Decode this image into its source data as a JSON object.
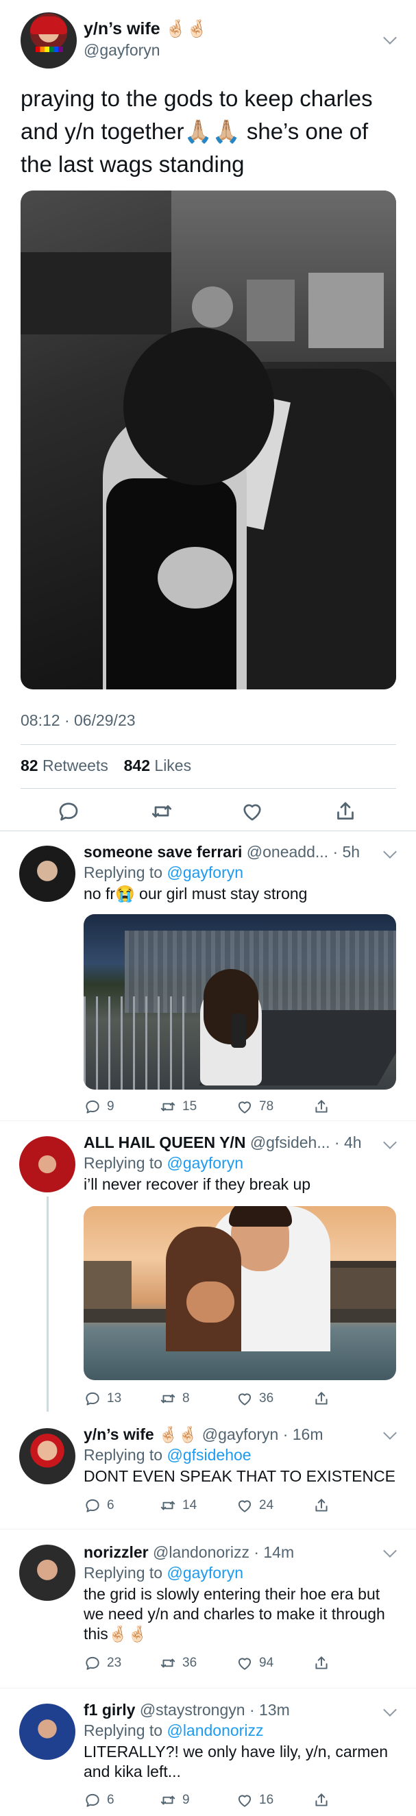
{
  "main_tweet": {
    "author_name": "y/n’s wife 🤞🏻🤞🏻",
    "author_handle": "@gayforyn",
    "text": "praying to the gods to keep charles and y/n together🙏🏼🙏🏼 she’s one of the last wags standing",
    "timestamp": "08:12 · 06/29/23",
    "retweets_count": "82",
    "retweets_label": "Retweets",
    "likes_count": "842",
    "likes_label": "Likes"
  },
  "replies": [
    {
      "name": "someone save ferrari",
      "meta": "@oneadd... · 5h",
      "replying_prefix": "Replying to ",
      "replying_to": "@gayforyn",
      "text": "no fr😭 our girl must stay strong",
      "replies": "9",
      "retweets": "15",
      "likes": "78"
    },
    {
      "name": "ALL HAIL QUEEN Y/N",
      "meta": "@gfsideh... · 4h",
      "replying_prefix": "Replying to ",
      "replying_to": "@gayforyn",
      "text": "i’ll never recover if they break up",
      "replies": "13",
      "retweets": "8",
      "likes": "36"
    },
    {
      "name": "y/n’s wife 🤞🏻🤞🏻",
      "meta": "@gayforyn · 16m",
      "replying_prefix": "Replying to ",
      "replying_to": "@gfsidehoe",
      "text": "DONT EVEN SPEAK THAT TO EXISTENCE",
      "replies": "6",
      "retweets": "14",
      "likes": "24"
    },
    {
      "name": "norizzler",
      "meta": "@landonorizz · 14m",
      "replying_prefix": "Replying to ",
      "replying_to": "@gayforyn",
      "text": "the grid is slowly entering their hoe era but we need y/n and charles to make it through this🤞🏻🤞🏻",
      "replies": "23",
      "retweets": "36",
      "likes": "94"
    },
    {
      "name": "f1 girly",
      "meta": "@staystrongyn · 13m",
      "replying_prefix": "Replying to ",
      "replying_to": "@landonorizz",
      "text": "LITERALLY?! we only have lily, y/n, carmen and kika left...",
      "replies": "6",
      "retweets": "9",
      "likes": "16"
    }
  ],
  "colors": {
    "text": "#0f1419",
    "secondary": "#536471",
    "link": "#1d9bf0",
    "divider": "#cfd9de"
  }
}
